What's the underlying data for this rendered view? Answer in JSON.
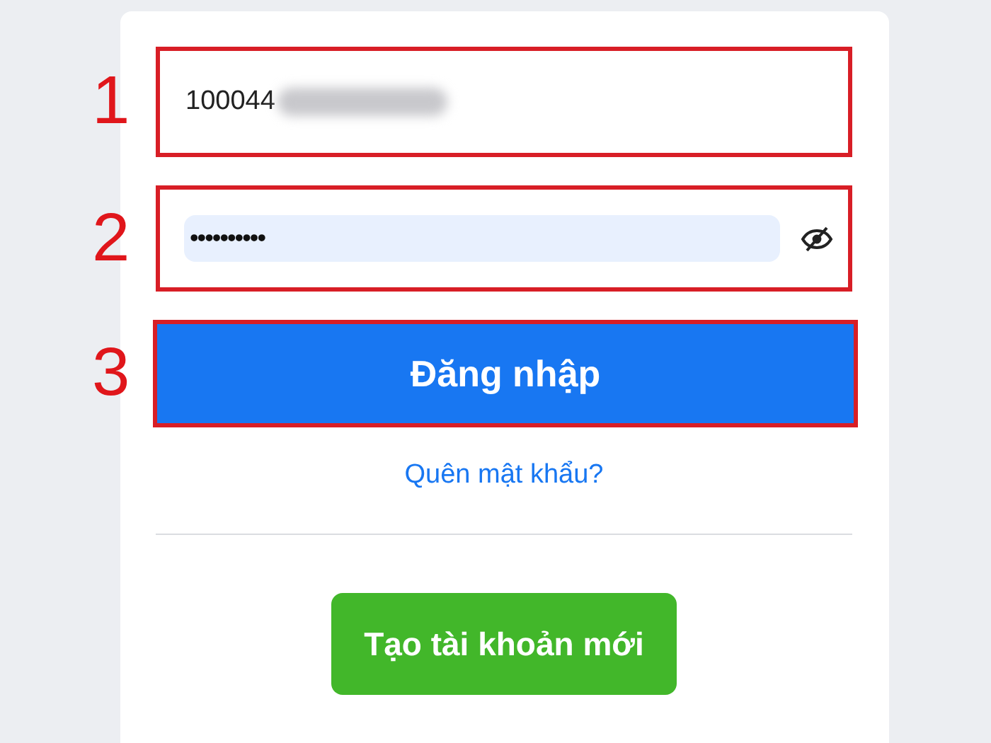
{
  "steps": [
    {
      "number": "1",
      "kind": "text_field",
      "value": "100044",
      "redacted": true
    },
    {
      "number": "2",
      "kind": "password_field",
      "value": "••••••••••"
    },
    {
      "number": "3",
      "kind": "button",
      "label": "Đăng nhập"
    }
  ],
  "forgot_link": "Quên mật khẩu?",
  "create_button": "Tạo tài khoản mới"
}
